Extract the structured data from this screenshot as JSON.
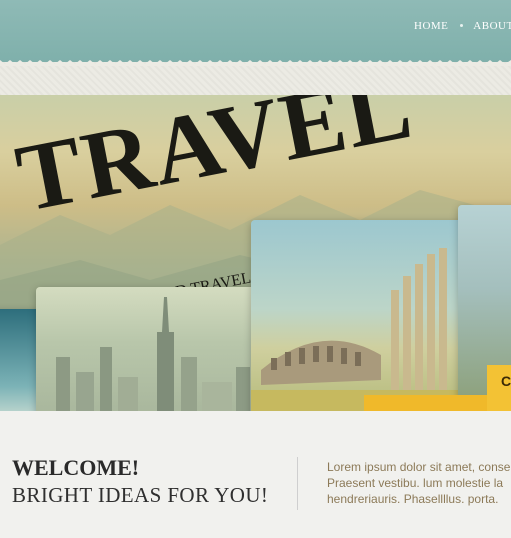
{
  "header": {
    "nav": [
      "HOME",
      "ABOUT"
    ]
  },
  "hero": {
    "title": "TRAVEL",
    "subtitle": "WORLD TRAVEL AGENCY",
    "right_cta_letter": "C"
  },
  "content": {
    "welcome": "WELCOME!",
    "tagline": "BRIGHT IDEAS FOR YOU!",
    "description_lines": [
      "Lorem ipsum dolor sit amet, conse",
      "Praesent vestibu.  lum molestie la",
      "hendreriauris. Phasellllus. porta."
    ]
  },
  "colors": {
    "header_teal": "#86b6b1",
    "cta_yellow": "#f0b92a",
    "text_dark": "#2a2a2a",
    "desc_brown": "#8c7a58"
  }
}
